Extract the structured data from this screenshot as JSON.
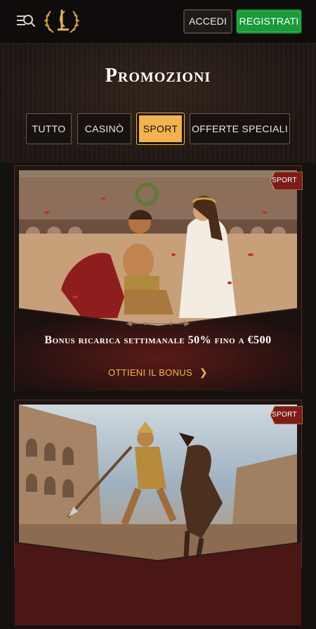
{
  "header": {
    "login_label": "ACCEDI",
    "register_label": "REGISTRATI"
  },
  "page": {
    "title": "Promozioni"
  },
  "filters": [
    {
      "label": "TUTTO",
      "active": false
    },
    {
      "label": "CASINÒ",
      "active": false
    },
    {
      "label": "SPORT",
      "active": true
    },
    {
      "label": "OFFERTE SPECIALI",
      "active": false
    }
  ],
  "promos": [
    {
      "tag": "SPORT",
      "title": "Bonus ricarica settimanale 50% fino a €500",
      "cta": "OTTIENI IL BONUS"
    },
    {
      "tag": "SPORT"
    }
  ],
  "colors": {
    "accent_gold": "#f1b24f",
    "register_green": "#1a9a3a",
    "card_border": "#5a2a26",
    "tag_red": "#7c1d1a"
  },
  "icons": {
    "menu_search": "menu-search-icon",
    "cta_arrow": "chevron-right-icon"
  }
}
